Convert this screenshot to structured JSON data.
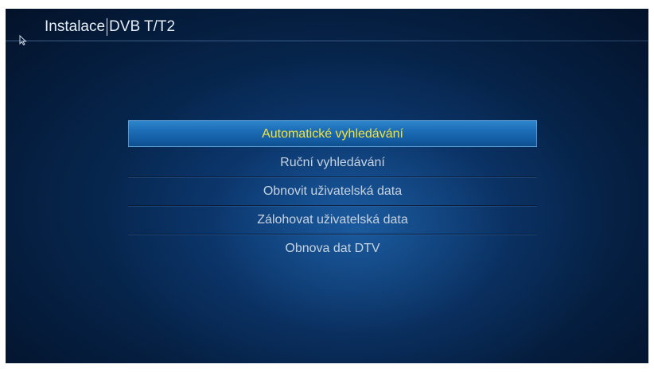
{
  "header": {
    "section": "Instalace",
    "subsection": "DVB T/T2"
  },
  "menu": {
    "selected_index": 0,
    "items": [
      {
        "label": "Automatické vyhledávání"
      },
      {
        "label": "Ruční vyhledávání"
      },
      {
        "label": "Obnovit uživatelská data"
      },
      {
        "label": "Zálohovat uživatelská data"
      },
      {
        "label": "Obnova dat DTV"
      }
    ]
  },
  "colors": {
    "background": "#06244a",
    "highlight": "#1d6fb8",
    "selected_text": "#f2e23a",
    "menu_text": "#c7d3e0"
  }
}
